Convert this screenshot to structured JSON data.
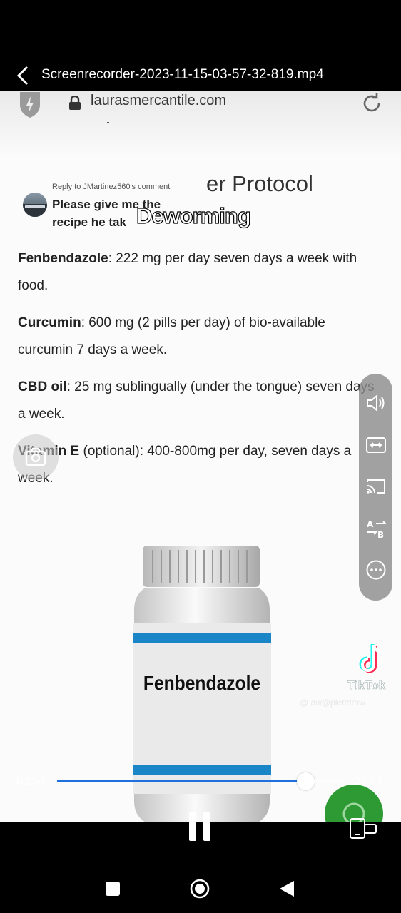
{
  "header": {
    "filename": "Screenrecorder-2023-11-15-03-57-32-819.mp4"
  },
  "video": {
    "url": "laurasmercantile.com",
    "heading_partial": "er Protocol",
    "reply_meta": "Reply to JMartinez560's comment",
    "reply_text": "Please give me the recipe he tak",
    "overlay_caption": "Deworming",
    "paragraphs": [
      {
        "name": "Fenbendazole",
        "text": ": 222 mg per day seven days a week with food."
      },
      {
        "name": "Curcumin",
        "text": ": 600 mg (2 pills per day) of bio-available curcumin 7 days a week."
      },
      {
        "name": "CBD oil",
        "text": ": 25 mg sublingually (under the tongue) seven days a week."
      },
      {
        "name": "Vitamin E",
        "text": " (optional): 400-800mg per day, seven days a week."
      }
    ],
    "bottle_label": "Fenbendazole",
    "watermark": {
      "brand": "TikTok",
      "user": "@ aw@plettdraw"
    }
  },
  "player": {
    "current_time": "03:54",
    "total_time": "04:24",
    "progress": 0.866,
    "accent_color": "#1e6fe0",
    "side_tools": [
      "volume-icon",
      "aspect-ratio-icon",
      "cast-icon",
      "translate-icon",
      "more-icon"
    ]
  }
}
